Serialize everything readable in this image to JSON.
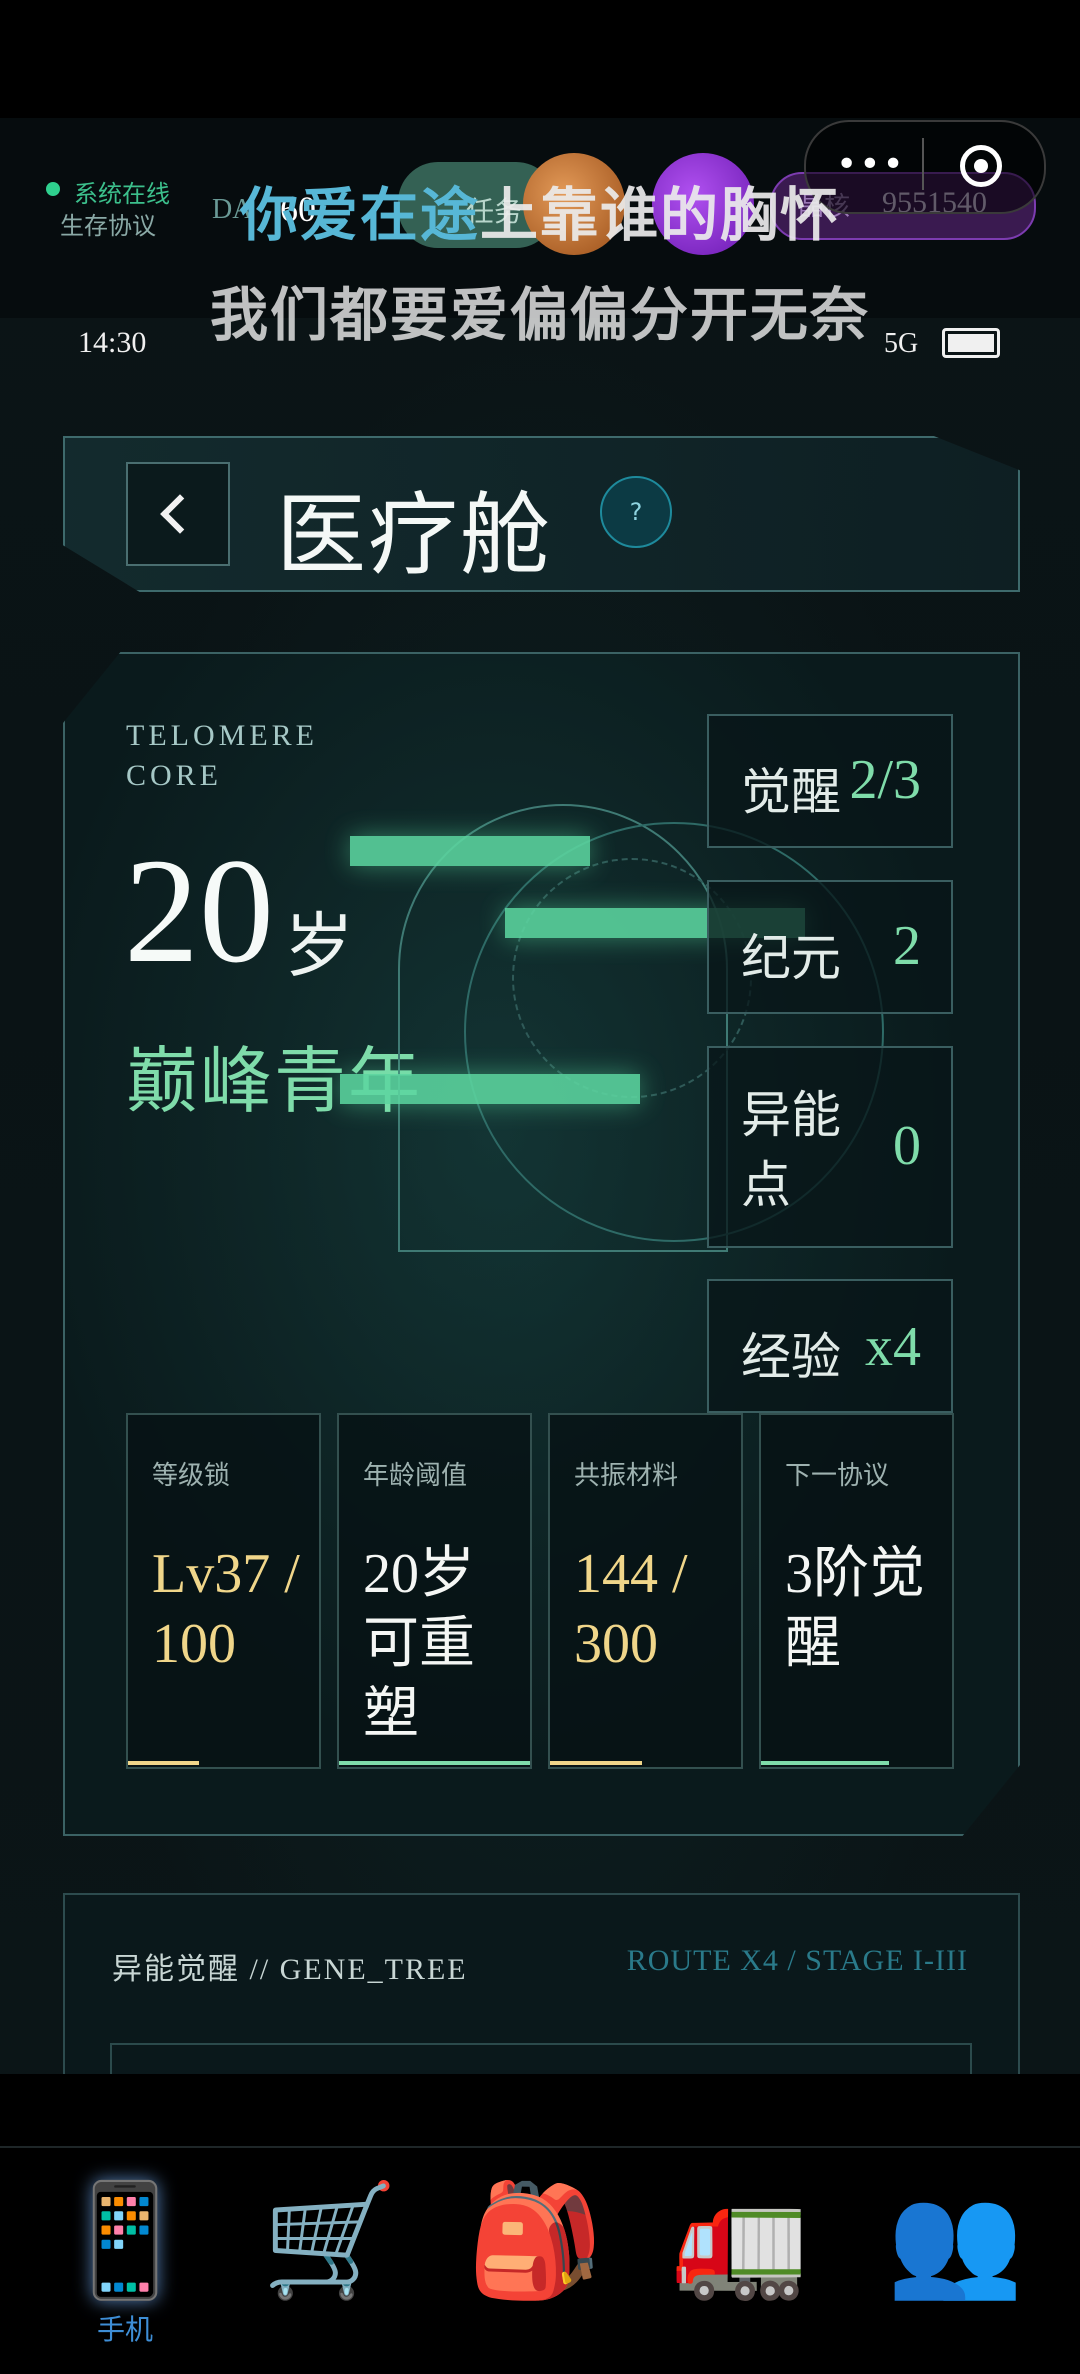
{
  "hud": {
    "online": "系统在线",
    "protocol": "生存协议",
    "day": "DA",
    "sixty": "60",
    "task": "任务",
    "coin_label": "晶核",
    "coin_value": "9551540"
  },
  "lyrics": {
    "line1_highlight": "你爱在途",
    "line1_rest": "上靠谁的胸怀",
    "line2": "我们都要爱偏偏分开无奈"
  },
  "status_bar": {
    "time": "14:30",
    "network": "5G"
  },
  "header": {
    "title": "医疗舱",
    "help": "?"
  },
  "core": {
    "label": "TELOMERE CORE",
    "age": "20",
    "age_unit": "岁",
    "phase": "巅峰青年"
  },
  "stats": [
    {
      "label": "觉醒",
      "value": "2/3"
    },
    {
      "label": "纪元",
      "value": "2"
    },
    {
      "label": "异能点",
      "value": "0"
    },
    {
      "label": "经验",
      "value": "x4"
    }
  ],
  "metrics": [
    {
      "label": "等级锁",
      "value": "Lv37 / 100",
      "color": "#f0d68a",
      "progress": 0.37
    },
    {
      "label": "年龄阈值",
      "value": "20岁可重塑",
      "color": "#7fdcaa",
      "progress": 1.0
    },
    {
      "label": "共振材料",
      "value": "144 / 300",
      "color": "#f0d68a",
      "progress": 0.48
    },
    {
      "label": "下一协议",
      "value": "3阶觉醒",
      "color": "#7fdcaa",
      "progress": 0.67
    }
  ],
  "gene_tree": {
    "title": "异能觉醒 // GENE_TREE",
    "route": "ROUTE X4 / STAGE I-III"
  },
  "tabbar": {
    "items": [
      {
        "icon": "phone-icon",
        "glyph": "📱",
        "label": "手机"
      },
      {
        "icon": "cart-icon",
        "glyph": "🛒",
        "label": ""
      },
      {
        "icon": "backpack-icon",
        "glyph": "🎒",
        "label": ""
      },
      {
        "icon": "truck-icon",
        "glyph": "🚛",
        "label": ""
      },
      {
        "icon": "people-icon",
        "glyph": "👥",
        "label": ""
      }
    ]
  },
  "colors": {
    "accent_green": "#7fdcaa",
    "gold": "#f0d68a",
    "tab_active": "#3e8ed6"
  }
}
